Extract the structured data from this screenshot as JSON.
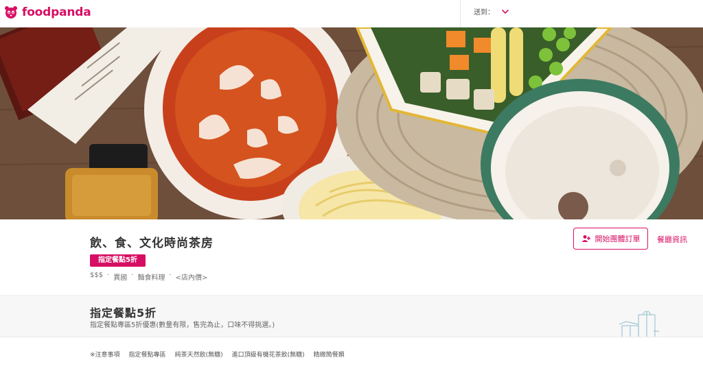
{
  "header": {
    "brand": "foodpanda",
    "deliver_label": "送到："
  },
  "vendor": {
    "name": "飲、食、文化時尚茶房",
    "promo_badge": "指定餐點5折",
    "meta": {
      "price": "$$$",
      "sep": "·",
      "cuisine1": "異國",
      "cuisine2": "麵食料理",
      "price_note": "<店內價>"
    },
    "group_order_label": "開始團體訂單",
    "info_label": "餐廳資訊"
  },
  "deal": {
    "title": "指定餐點5折",
    "description": "指定餐點專區5折優惠(數量有限，售完為止，口味不得挑選。)"
  },
  "menu_nav": {
    "items": [
      "※注意事項",
      "指定餐點專區",
      "純茶天然飲(無糖)",
      "進口頂級有機花茶飲(無糖)",
      "精緻簡餐類"
    ]
  },
  "colors": {
    "brand": "#d70f64"
  },
  "icons": {
    "logo": "panda-logo-icon",
    "deliver": "chevron-down-icon",
    "group": "group-users-icon",
    "gift": "gift-box-icon"
  }
}
